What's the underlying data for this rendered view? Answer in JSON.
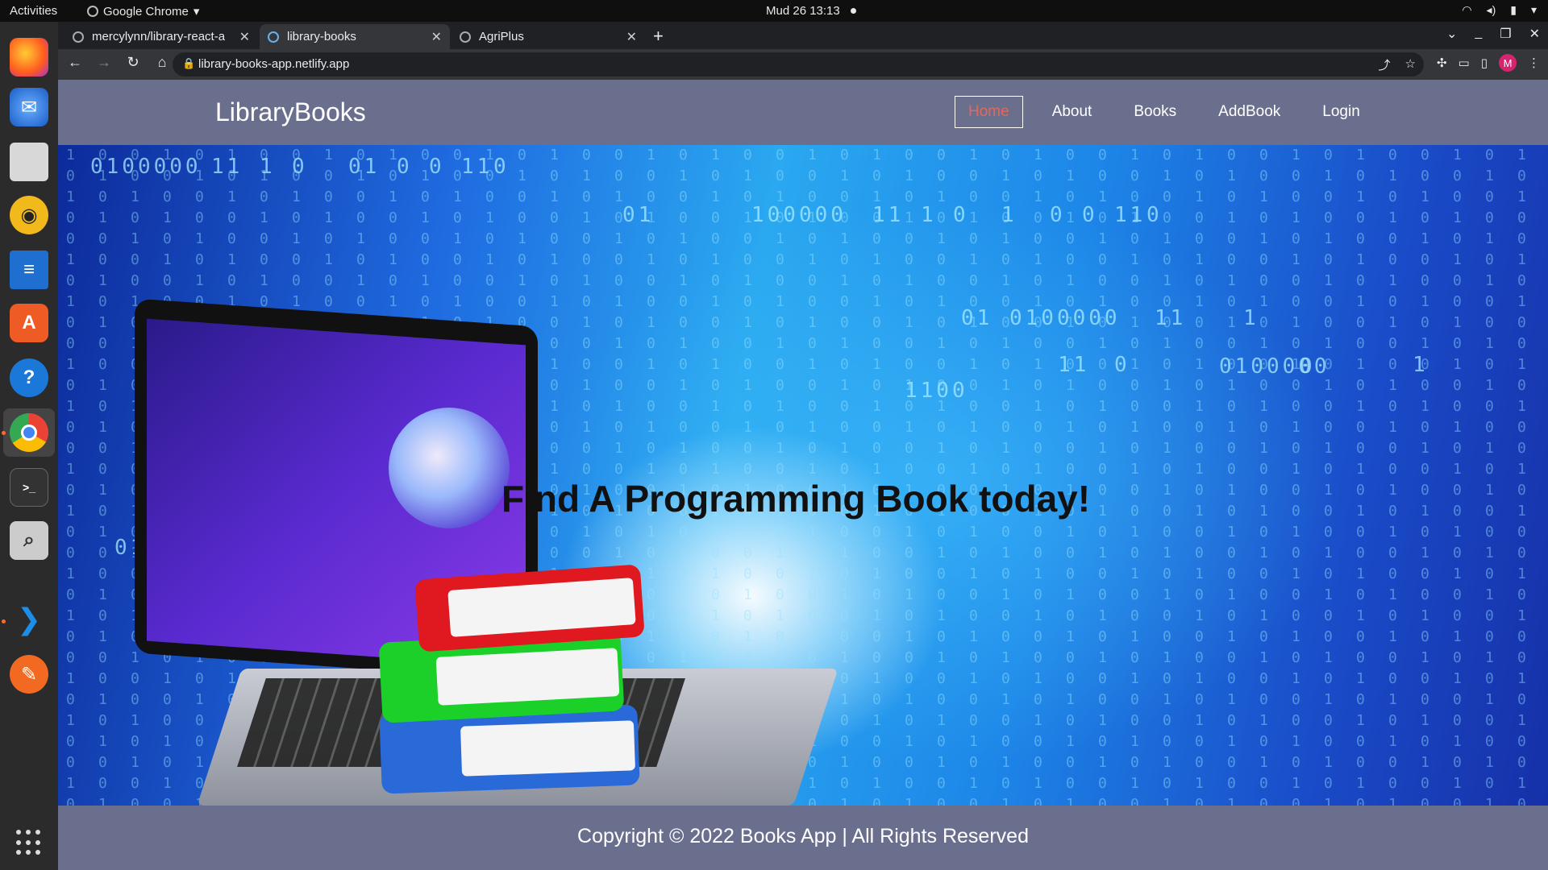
{
  "topbar": {
    "activities": "Activities",
    "app_name": "Google Chrome",
    "clock": "Mud 26  13:13"
  },
  "dock": {
    "apps": [
      "firefox-icon",
      "thunderbird-icon",
      "files-icon",
      "rhythmbox-icon",
      "writer-icon",
      "software-icon",
      "help-icon",
      "chrome-icon",
      "terminal-icon",
      "search-icon",
      "vscode-icon",
      "pen-icon"
    ]
  },
  "browser": {
    "tabs": [
      {
        "label": "mercylynn/library-react-a"
      },
      {
        "label": "library-books"
      },
      {
        "label": "AgriPlus"
      }
    ],
    "url": "library-books-app.netlify.app",
    "profile_initial": "M"
  },
  "site": {
    "brand": "LibraryBooks",
    "nav": [
      {
        "label": "Home"
      },
      {
        "label": "About"
      },
      {
        "label": "Books"
      },
      {
        "label": "AddBook"
      },
      {
        "label": "Login"
      }
    ],
    "hero": {
      "headline": "Find A Programming Book today!",
      "bg_digits": [
        "0100000",
        "11",
        "1",
        "0",
        "01",
        "0",
        "0",
        "11",
        "0",
        "01",
        "100000",
        "11",
        "1",
        "0",
        "1",
        "0",
        "0",
        "11",
        "0",
        "1100",
        "01",
        "0100000",
        "11",
        "1",
        "0",
        "11",
        "0",
        "0100000",
        "01",
        "1"
      ]
    },
    "footer": "Copyright © 2022 Books App | All Rights Reserved"
  },
  "colors": {
    "navbar_bg": "#6b6f8e",
    "home_active": "#e06a5a",
    "chrome_dark": "#202124"
  }
}
